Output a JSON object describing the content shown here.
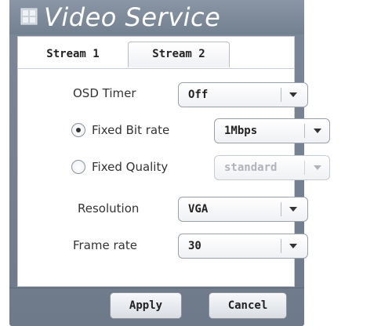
{
  "dialog": {
    "title": "Video Service",
    "icon": "grid-icon"
  },
  "tabs": [
    {
      "label": "Stream 1",
      "active": true
    },
    {
      "label": "Stream 2",
      "active": false
    }
  ],
  "form": {
    "osd_timer": {
      "label": "OSD Timer",
      "value": "Off"
    },
    "bitrate_mode": {
      "fixed_bit_rate": {
        "label": "Fixed Bit rate",
        "selected": true,
        "value": "1Mbps"
      },
      "fixed_quality": {
        "label": "Fixed Quality",
        "selected": false,
        "value": "standard",
        "disabled": true
      }
    },
    "resolution": {
      "label": "Resolution",
      "value": "VGA"
    },
    "frame_rate": {
      "label": "Frame rate",
      "value": "30"
    }
  },
  "footer": {
    "apply_label": "Apply",
    "cancel_label": "Cancel"
  },
  "colors": {
    "panel": "#7c8898",
    "title_text": "#ffffff",
    "content_bg": "#ffffff"
  }
}
